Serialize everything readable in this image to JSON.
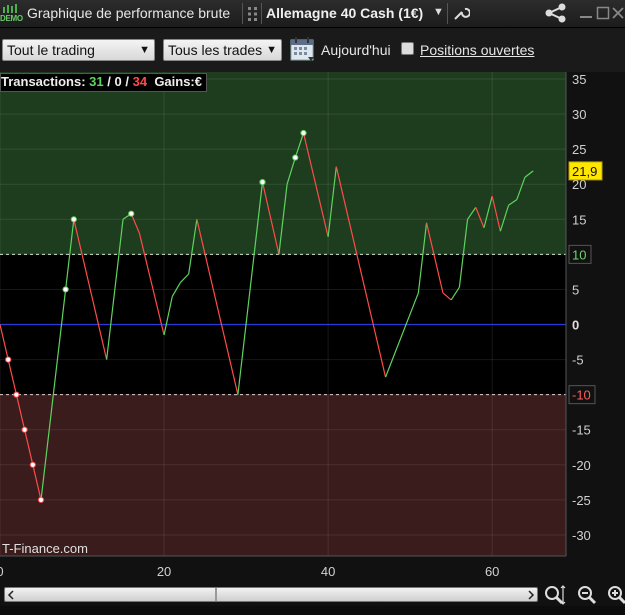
{
  "window": {
    "logo_text": "DEMO",
    "title": "Graphique de performance brute",
    "instrument": "Allemagne 40 Cash (1€)"
  },
  "toolbar": {
    "scope_select": "Tout le trading",
    "trades_select": "Tous les trades",
    "today_label": "Aujourd'hui",
    "open_positions_label": "Positions ouvertes",
    "open_positions_checked": false
  },
  "stats": {
    "label": "Transactions:",
    "winners": "31",
    "sep1": "/",
    "neutral": "0",
    "sep2": "/",
    "losers": "34",
    "gains_label": "Gains:",
    "gains_currency": "€"
  },
  "watermark": "T-Finance.com",
  "colors": {
    "up": "#5fd35f",
    "down": "#ff4b4b",
    "zone_profit": "#1e3d1e",
    "zone_loss": "#3a1c1c",
    "zero_line": "#2a3bd9",
    "last_value_bg": "#ffe600"
  },
  "chart_data": {
    "type": "line",
    "x_ticks": [
      "0",
      "20",
      "40",
      "60"
    ],
    "y_ticks": [
      "35",
      "30",
      "25",
      "20",
      "15",
      "10",
      "5",
      "0",
      "-5",
      "-10",
      "-15",
      "-20",
      "-25",
      "-30"
    ],
    "xlim": [
      0,
      69
    ],
    "ylim": [
      -33,
      36
    ],
    "upper_threshold": 10,
    "lower_threshold": -10,
    "last_value": "21,9",
    "upper_label": "10",
    "zero_label": "0",
    "lower_label": "-10",
    "points": [
      [
        0,
        0
      ],
      [
        1,
        -5
      ],
      [
        2,
        -10
      ],
      [
        3,
        -15
      ],
      [
        4,
        -20
      ],
      [
        5,
        -25
      ],
      [
        8,
        5
      ],
      [
        9,
        15
      ],
      [
        13,
        -5
      ],
      [
        15,
        15
      ],
      [
        16,
        15.8
      ],
      [
        17,
        13
      ],
      [
        20,
        -1.5
      ],
      [
        21,
        4
      ],
      [
        22,
        6
      ],
      [
        23,
        7.2
      ],
      [
        24,
        15
      ],
      [
        29,
        -10
      ],
      [
        32,
        20.3
      ],
      [
        34,
        10
      ],
      [
        35,
        20
      ],
      [
        36,
        23.8
      ],
      [
        37,
        27.3
      ],
      [
        40,
        12.5
      ],
      [
        41,
        22.5
      ],
      [
        47,
        -7.5
      ],
      [
        51,
        4.5
      ],
      [
        52,
        14.5
      ],
      [
        54,
        4.5
      ],
      [
        55,
        3.5
      ],
      [
        56,
        5.3
      ],
      [
        57,
        15
      ],
      [
        58,
        16.7
      ],
      [
        59,
        13.8
      ],
      [
        60,
        18.3
      ],
      [
        61,
        13.3
      ],
      [
        62,
        17
      ],
      [
        63,
        17.8
      ],
      [
        64,
        21
      ],
      [
        65,
        21.9
      ]
    ],
    "markers": [
      [
        1,
        -5
      ],
      [
        2,
        -10
      ],
      [
        3,
        -15
      ],
      [
        4,
        -20
      ],
      [
        5,
        -25
      ],
      [
        8,
        5
      ],
      [
        9,
        15
      ],
      [
        16,
        15.8
      ],
      [
        32,
        20.3
      ],
      [
        36,
        23.8
      ],
      [
        37,
        27.3
      ]
    ]
  }
}
